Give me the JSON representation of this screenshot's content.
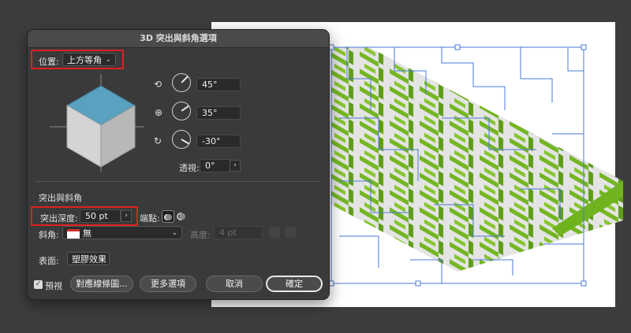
{
  "dialog": {
    "title": "3D 突出與斜角選項",
    "position_label": "位置:",
    "position_value": "上方等角",
    "rotation": {
      "x_angle": "45°",
      "y_angle": "35°",
      "z_angle": "-30°"
    },
    "perspective_label": "透視:",
    "perspective_value": "0°",
    "extrude_section_label": "突出與斜角",
    "extrude_depth_label": "突出深度:",
    "extrude_depth_value": "50 pt",
    "cap_label": "端點:",
    "bevel_label": "斜角:",
    "bevel_value": "無",
    "height_label": "高度:",
    "height_value": "4 pt",
    "surface_label": "表面:",
    "surface_value": "塑膠效果",
    "preview_label": "預視",
    "map_art_button": "對應線條圖...",
    "more_options_button": "更多選項",
    "cancel_button": "取消",
    "ok_button": "確定"
  },
  "colors": {
    "maze_green": "#6fb31f",
    "maze_top": "#e6e6e6",
    "cube_top": "#5aa0bf",
    "highlight": "#e02020",
    "selection_blue": "#4a78d8"
  }
}
